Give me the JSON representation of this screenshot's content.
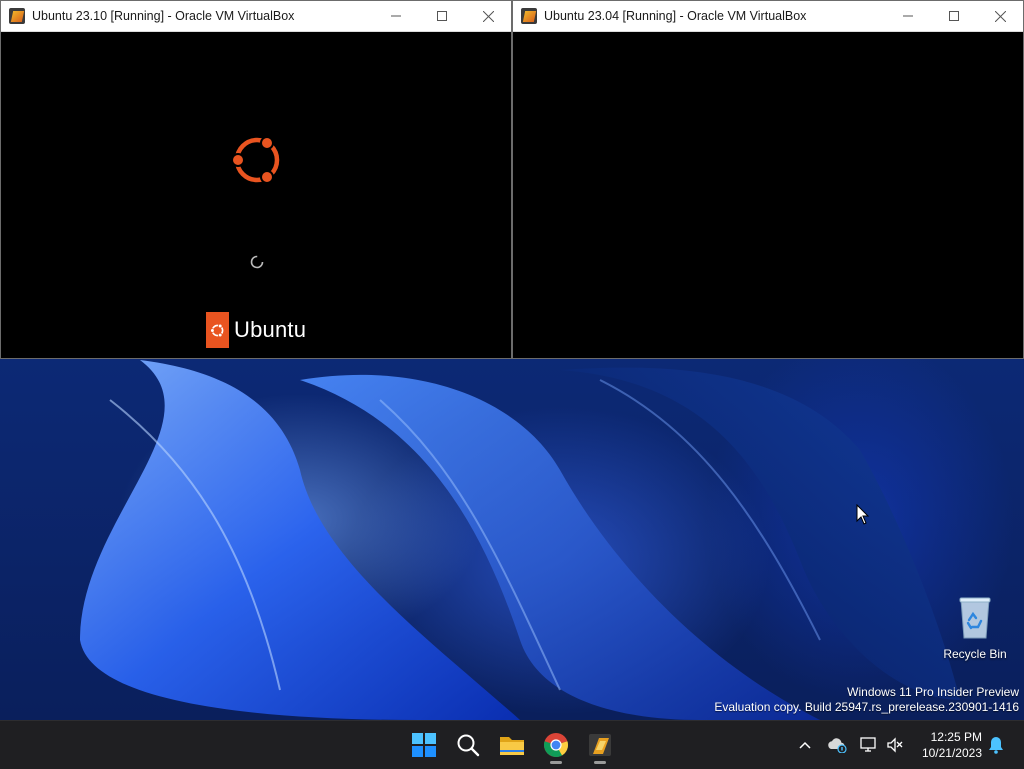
{
  "vm_windows": [
    {
      "title": "Ubuntu 23.10 [Running] - Oracle VM VirtualBox",
      "screen": {
        "brand_word": "Ubuntu"
      }
    },
    {
      "title": "Ubuntu 23.04 [Running] - Oracle VM VirtualBox"
    }
  ],
  "desktop": {
    "icons": [
      {
        "label": "Recycle Bin",
        "icon": "recycle-bin-icon"
      }
    ],
    "watermark": {
      "line1": "Windows 11 Pro Insider Preview",
      "line2": "Evaluation copy. Build 25947.rs_prerelease.230901-1416"
    }
  },
  "taskbar": {
    "apps": [
      {
        "name": "start",
        "icon": "windows-start-icon"
      },
      {
        "name": "search",
        "icon": "search-icon"
      },
      {
        "name": "file-explorer",
        "icon": "folder-icon"
      },
      {
        "name": "chrome",
        "icon": "chrome-icon",
        "running": true
      },
      {
        "name": "virtualbox",
        "icon": "virtualbox-icon",
        "running": true
      }
    ],
    "tray": {
      "icons": [
        "chevron-up-icon",
        "onedrive-icon",
        "network-icon",
        "volume-muted-icon",
        "notification-bell-icon"
      ],
      "time": "12:25 PM",
      "date": "10/21/2023"
    }
  },
  "colors": {
    "ubuntu_orange": "#e95420",
    "taskbar": "#1f1f22",
    "windows_blue": "#0078d4"
  }
}
